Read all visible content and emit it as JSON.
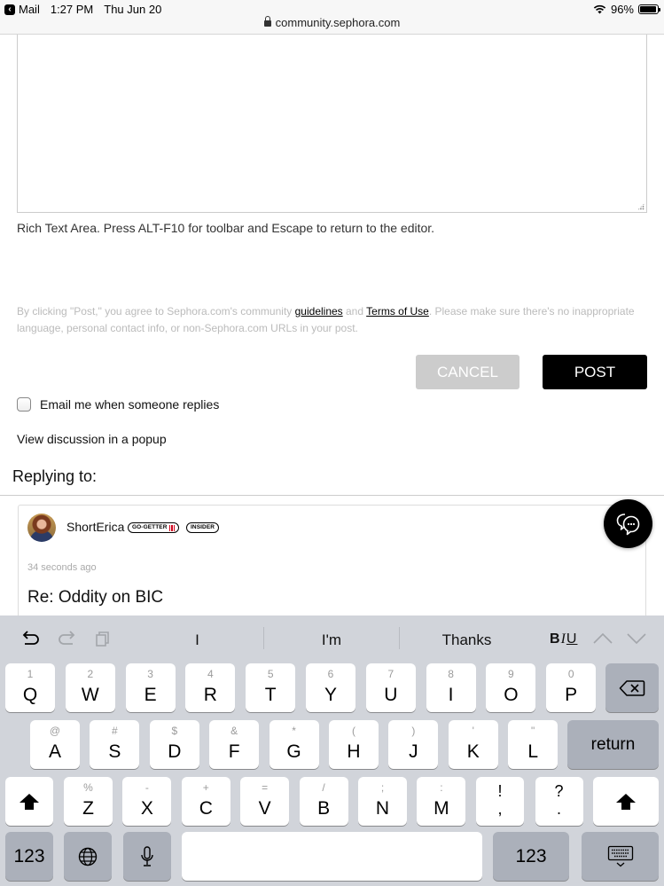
{
  "status_bar": {
    "back_app": "Mail",
    "time": "1:27 PM",
    "date": "Thu Jun 20",
    "battery": "96%",
    "battery_level": 0.96
  },
  "browser": {
    "url": "community.sephora.com"
  },
  "editor": {
    "rich_text_note": "Rich Text Area. Press ALT-F10 for toolbar and Escape to return to the editor."
  },
  "terms": {
    "prefix": "By clicking \"Post,\" you agree to Sephora.com's community ",
    "guidelines_link": "guidelines",
    "and": " and ",
    "terms_link": "Terms of Use",
    "suffix": ". Please make sure there's no inappropriate language, personal contact info, or non-Sephora.com URLs in your post."
  },
  "actions": {
    "cancel_label": "CANCEL",
    "post_label": "POST"
  },
  "options": {
    "email_label": "Email me when someone replies",
    "email_checked": false,
    "popup_link": "View discussion in a popup"
  },
  "replying": {
    "heading": "Replying to:",
    "username": "ShortErica",
    "badges": [
      "GO-GETTER",
      "INSIDER"
    ],
    "timestamp": "34 seconds ago",
    "title": "Re: Oddity on BIC"
  },
  "keyboard": {
    "suggestions": [
      "I",
      "I'm",
      "Thanks"
    ],
    "format": {
      "bold": "B",
      "italic": "I",
      "underline": "U"
    },
    "row1": [
      {
        "main": "Q",
        "sub": "1"
      },
      {
        "main": "W",
        "sub": "2"
      },
      {
        "main": "E",
        "sub": "3"
      },
      {
        "main": "R",
        "sub": "4"
      },
      {
        "main": "T",
        "sub": "5"
      },
      {
        "main": "Y",
        "sub": "6"
      },
      {
        "main": "U",
        "sub": "7"
      },
      {
        "main": "I",
        "sub": "8"
      },
      {
        "main": "O",
        "sub": "9"
      },
      {
        "main": "P",
        "sub": "0"
      }
    ],
    "row2": [
      {
        "main": "A",
        "sub": "@"
      },
      {
        "main": "S",
        "sub": "#"
      },
      {
        "main": "D",
        "sub": "$"
      },
      {
        "main": "F",
        "sub": "&"
      },
      {
        "main": "G",
        "sub": "*"
      },
      {
        "main": "H",
        "sub": "("
      },
      {
        "main": "J",
        "sub": ")"
      },
      {
        "main": "K",
        "sub": "'"
      },
      {
        "main": "L",
        "sub": "\""
      }
    ],
    "row3": [
      {
        "main": "Z",
        "sub": "%"
      },
      {
        "main": "X",
        "sub": "-"
      },
      {
        "main": "C",
        "sub": "+"
      },
      {
        "main": "V",
        "sub": "="
      },
      {
        "main": "B",
        "sub": "/"
      },
      {
        "main": "N",
        "sub": ";"
      },
      {
        "main": "M",
        "sub": ":"
      }
    ],
    "punct": [
      {
        "top": "!",
        "bottom": ","
      },
      {
        "top": "?",
        "bottom": "."
      }
    ],
    "return_label": "return",
    "numbers_label": "123"
  }
}
